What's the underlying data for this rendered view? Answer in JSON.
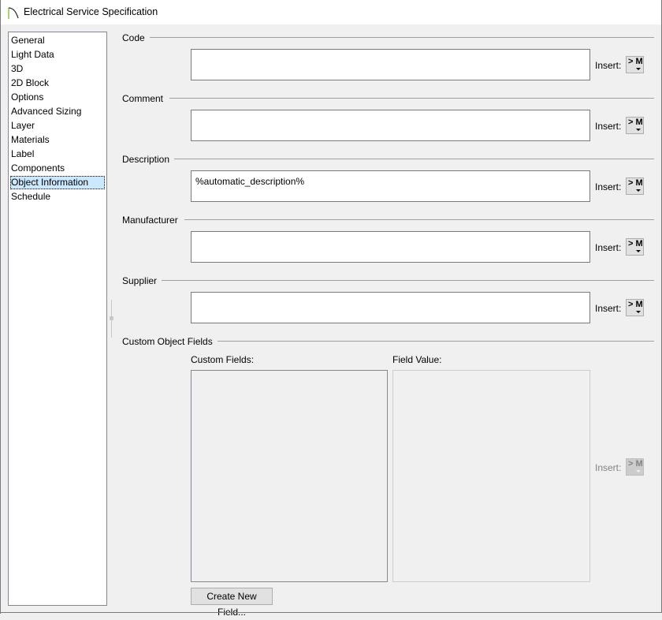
{
  "window": {
    "title": "Electrical Service Specification"
  },
  "sidebar": {
    "items": [
      {
        "label": "General"
      },
      {
        "label": "Light Data"
      },
      {
        "label": "3D"
      },
      {
        "label": "2D Block"
      },
      {
        "label": "Options"
      },
      {
        "label": "Advanced Sizing"
      },
      {
        "label": "Layer"
      },
      {
        "label": "Materials"
      },
      {
        "label": "Label"
      },
      {
        "label": "Components"
      },
      {
        "label": "Object Information",
        "selected": true
      },
      {
        "label": "Schedule"
      }
    ]
  },
  "fields": {
    "code": {
      "label": "Code",
      "value": "",
      "insert_label": "Insert:",
      "insert_glyph": "> M"
    },
    "comment": {
      "label": "Comment",
      "value": "",
      "insert_label": "Insert:",
      "insert_glyph": "> M"
    },
    "description": {
      "label": "Description",
      "value": "%automatic_description%",
      "insert_label": "Insert:",
      "insert_glyph": "> M"
    },
    "manufacturer": {
      "label": "Manufacturer",
      "value": "",
      "insert_label": "Insert:",
      "insert_glyph": "> M"
    },
    "supplier": {
      "label": "Supplier",
      "value": "",
      "insert_label": "Insert:",
      "insert_glyph": "> M"
    }
  },
  "custom": {
    "group_label": "Custom Object Fields",
    "fields_label": "Custom Fields:",
    "value_label": "Field Value:",
    "insert_label": "Insert:",
    "insert_glyph": "> M",
    "create_button": "Create New Field..."
  },
  "colors": {
    "selection": "#cce8ff",
    "dialog_bg": "#f0f0f0",
    "icon_accent": "#8dc63f"
  }
}
